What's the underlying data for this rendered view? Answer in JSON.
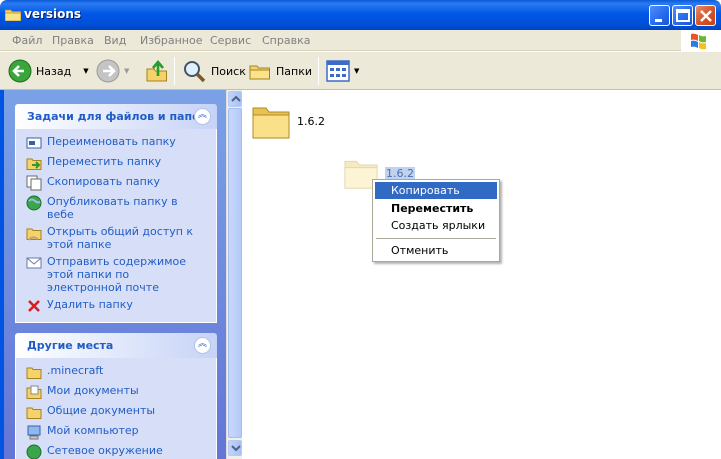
{
  "window": {
    "title": "versions"
  },
  "menubar": {
    "items": [
      "Файл",
      "Правка",
      "Вид",
      "Избранное",
      "Сервис",
      "Справка"
    ]
  },
  "toolbar": {
    "back_label": "Назад",
    "search_label": "Поиск",
    "folders_label": "Папки"
  },
  "sidebar": {
    "tasks": {
      "title": "Задачи для файлов и папок",
      "items": [
        {
          "label": "Переименовать папку",
          "icon": "rename-icon"
        },
        {
          "label": "Переместить папку",
          "icon": "move-icon"
        },
        {
          "label": "Скопировать папку",
          "icon": "copy-icon"
        },
        {
          "label": "Опубликовать папку в вебе",
          "icon": "globe-icon"
        },
        {
          "label": "Открыть общий доступ к этой папке",
          "icon": "share-icon"
        },
        {
          "label": "Отправить содержимое этой папки по электронной почте",
          "icon": "email-icon"
        },
        {
          "label": "Удалить папку",
          "icon": "delete-icon"
        }
      ]
    },
    "places": {
      "title": "Другие места",
      "items": [
        {
          "label": ".minecraft",
          "icon": "folder-icon"
        },
        {
          "label": "Мои документы",
          "icon": "my-documents-icon"
        },
        {
          "label": "Общие документы",
          "icon": "folder-icon"
        },
        {
          "label": "Мой компьютер",
          "icon": "computer-icon"
        },
        {
          "label": "Сетевое окружение",
          "icon": "network-icon"
        }
      ]
    }
  },
  "content": {
    "folders": [
      {
        "name": "1.6.2"
      }
    ],
    "drag_ghost": {
      "name": "1.6.2"
    }
  },
  "context_menu": {
    "items": [
      "Копировать",
      "Переместить",
      "Создать ярлыки",
      "Отменить"
    ],
    "highlighted": "Копировать",
    "default": "Переместить"
  },
  "colors": {
    "titlebar": "#0058e6",
    "highlight": "#316ac5",
    "link": "#215dc6"
  }
}
